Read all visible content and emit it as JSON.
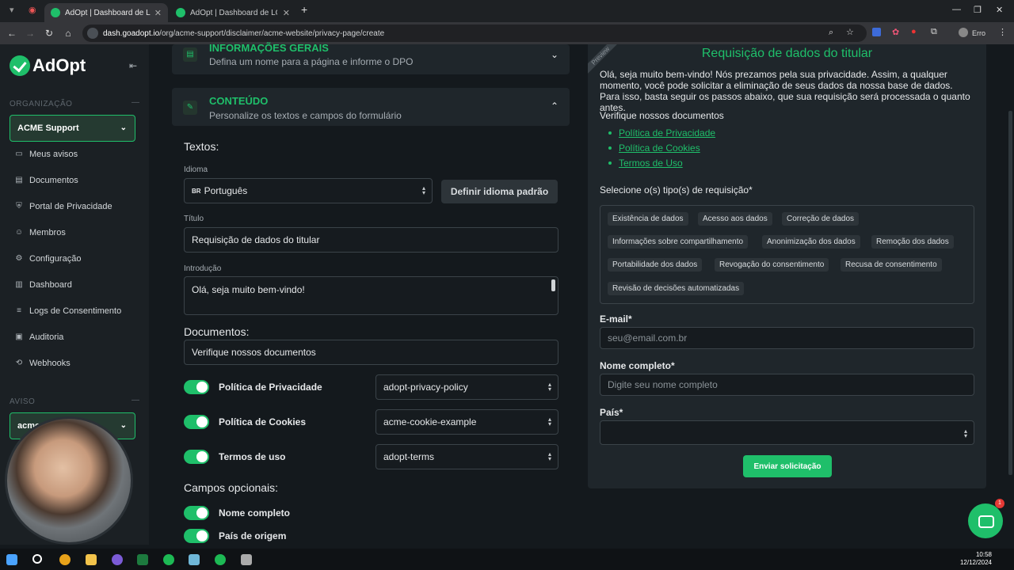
{
  "browser": {
    "tabs": [
      {
        "label": "AdOpt | Dashboard de LGPD",
        "active": true
      },
      {
        "label": "AdOpt | Dashboard de LGPD",
        "active": false
      }
    ],
    "url_host": "dash.goadopt.io",
    "url_path": "/org/acme-support/disclaimer/acme-website/privacy-page/create",
    "profile_label": "Erro"
  },
  "sidebar": {
    "brand": "AdOpt",
    "org_section": "ORGANIZAÇÃO",
    "org_selected": "ACME Support",
    "items": [
      {
        "label": "Meus avisos",
        "icon": "message-icon"
      },
      {
        "label": "Documentos",
        "icon": "document-icon"
      },
      {
        "label": "Portal de Privacidade",
        "icon": "shield-icon"
      },
      {
        "label": "Membros",
        "icon": "users-icon"
      },
      {
        "label": "Configuração",
        "icon": "gear-icon"
      },
      {
        "label": "Dashboard",
        "icon": "bar-chart-icon"
      },
      {
        "label": "Logs de Consentimento",
        "icon": "list-icon"
      },
      {
        "label": "Auditoria",
        "icon": "audit-icon"
      },
      {
        "label": "Webhooks",
        "icon": "webhook-icon"
      }
    ],
    "aviso_section": "AVISO",
    "aviso_selected": "acme"
  },
  "form": {
    "general": {
      "title": "INFORMAÇÕES GERAIS",
      "subtitle": "Defina um nome para a página e informe o DPO"
    },
    "content": {
      "title": "CONTEÚDO",
      "subtitle": "Personalize os textos e campos do formulário"
    },
    "texts_heading": "Textos:",
    "language_label": "Idioma",
    "language_flag": "BR",
    "language_value": "Português",
    "default_language_button": "Definir idioma padrão",
    "title_label": "Título",
    "title_value": "Requisição de dados do titular",
    "intro_label": "Introdução",
    "intro_value": "Olá, seja muito bem-vindo!",
    "documents_heading": "Documentos:",
    "documents_value": "Verifique nossos documentos",
    "document_toggles": [
      {
        "label": "Política de Privacidade",
        "value": "adopt-privacy-policy",
        "on": true
      },
      {
        "label": "Política de Cookies",
        "value": "acme-cookie-example",
        "on": true
      },
      {
        "label": "Termos de uso",
        "value": "adopt-terms",
        "on": true
      }
    ],
    "optional_heading": "Campos opcionais:",
    "optional_fields": [
      {
        "label": "Nome completo",
        "on": true
      },
      {
        "label": "País de origem",
        "on": true
      }
    ]
  },
  "preview": {
    "ribbon": "Preview",
    "title": "Requisição de dados do titular",
    "intro": "Olá, seja muito bem-vindo! Nós prezamos pela sua privacidade. Assim, a qualquer momento, você pode solicitar a eliminação de seus dados da nossa base de dados. Para isso, basta seguir os passos abaixo, que sua requisição será processada o quanto antes.",
    "docs_heading": "Verifique nossos documentos",
    "doc_links": [
      "Política de Privacidade",
      "Política de Cookies",
      "Termos de Uso"
    ],
    "request_label": "Selecione o(s) tipo(s) de requisição*",
    "request_types": [
      "Existência de dados",
      "Acesso aos dados",
      "Correção de dados",
      "Informações sobre compartilhamento",
      "Anonimização dos dados",
      "Remoção dos dados",
      "Portabilidade dos dados",
      "Revogação do consentimento",
      "Recusa de consentimento",
      "Revisão de decisões automatizadas"
    ],
    "email_label": "E-mail*",
    "email_placeholder": "seu@email.com.br",
    "name_label": "Nome completo*",
    "name_placeholder": "Digite seu nome completo",
    "country_label": "País*",
    "submit": "Enviar solicitação"
  },
  "chat_badge": "1",
  "taskbar": {
    "time": "10:58",
    "date": "12/12/2024"
  },
  "colors": {
    "accent": "#1fbf6a",
    "panel": "#1f262b",
    "background": "#14191d"
  }
}
